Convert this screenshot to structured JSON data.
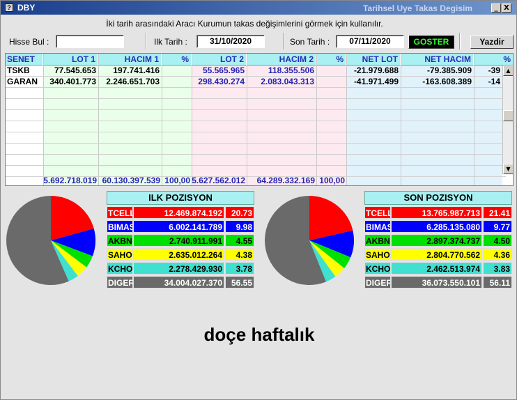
{
  "window": {
    "app_title": "DBY",
    "caption": "Tarihsel Uye Takas Degisim",
    "minimize": "_",
    "close": "X",
    "app_icon": "?"
  },
  "subtitle": "İki tarih arasındaki  Aracı Kurumun takas değişimlerini görmek için kullanılır.",
  "toolbar": {
    "hisse_label": "Hisse Bul :",
    "hisse_value": "",
    "ilk_label": "Ilk Tarih :",
    "ilk_value": "31/10/2020",
    "son_label": "Son Tarih :",
    "son_value": "07/11/2020",
    "goster_label": "GOSTER",
    "yazdir_label": "Yazdir"
  },
  "grid": {
    "headers": [
      "SENET",
      "LOT 1",
      "HACIM 1",
      "%",
      "LOT 2",
      "HACIM 2",
      "%",
      "NET LOT",
      "NET HACIM",
      "%"
    ],
    "rows": [
      [
        "TSKB",
        "77.545.653",
        "197.741.416",
        "",
        "55.565.965",
        "118.355.506",
        "",
        "-21.979.688",
        "-79.385.909",
        "-39"
      ],
      [
        "GARAN",
        "340.401.773",
        "2.246.651.703",
        "",
        "298.430.274",
        "2.083.043.313",
        "",
        "-41.971.499",
        "-163.608.389",
        "-14"
      ]
    ],
    "footer": [
      "",
      "5.692.718.019",
      "60.130.397.539",
      "100,00",
      "5.627.562.012",
      "64.289.332.169",
      "100,00",
      "",
      "",
      ""
    ]
  },
  "ilk_pozisyon": {
    "title": "ILK POZISYON",
    "rows": [
      {
        "name": "TCELL",
        "value": "12.469.874.192",
        "pct": "20.73",
        "pct_num": 20.73,
        "color": "#ff0000",
        "text": "#ffffff"
      },
      {
        "name": "BIMAS",
        "value": "6.002.141.789",
        "pct": "9.98",
        "pct_num": 9.98,
        "color": "#0000ff",
        "text": "#ffffff"
      },
      {
        "name": "AKBNK",
        "value": "2.740.911.991",
        "pct": "4.55",
        "pct_num": 4.55,
        "color": "#00e000",
        "text": "#000000"
      },
      {
        "name": "SAHOL",
        "value": "2.635.012.264",
        "pct": "4.38",
        "pct_num": 4.38,
        "color": "#ffff00",
        "text": "#000000"
      },
      {
        "name": "KCHOL",
        "value": "2.278.429.930",
        "pct": "3.78",
        "pct_num": 3.78,
        "color": "#40e0d0",
        "text": "#000000"
      },
      {
        "name": "DIGER",
        "value": "34.004.027.370",
        "pct": "56.55",
        "pct_num": 56.55,
        "color": "#6a6a6a",
        "text": "#ffffff"
      }
    ]
  },
  "son_pozisyon": {
    "title": "SON POZISYON",
    "rows": [
      {
        "name": "TCELL",
        "value": "13.765.987.713",
        "pct": "21.41",
        "pct_num": 21.41,
        "color": "#ff0000",
        "text": "#ffffff"
      },
      {
        "name": "BIMAS",
        "value": "6.285.135.080",
        "pct": "9.77",
        "pct_num": 9.77,
        "color": "#0000ff",
        "text": "#ffffff"
      },
      {
        "name": "AKBNK",
        "value": "2.897.374.737",
        "pct": "4.50",
        "pct_num": 4.5,
        "color": "#00e000",
        "text": "#000000"
      },
      {
        "name": "SAHOL",
        "value": "2.804.770.562",
        "pct": "4.36",
        "pct_num": 4.36,
        "color": "#ffff00",
        "text": "#000000"
      },
      {
        "name": "KCHOL",
        "value": "2.462.513.974",
        "pct": "3.83",
        "pct_num": 3.83,
        "color": "#40e0d0",
        "text": "#000000"
      },
      {
        "name": "DIGER",
        "value": "36.073.550.101",
        "pct": "56.11",
        "pct_num": 56.11,
        "color": "#6a6a6a",
        "text": "#ffffff"
      }
    ]
  },
  "watermark": "doçe haftalık",
  "colors": {
    "lot1_bg": "#eaffea",
    "lot2_bg": "#fdeaf0",
    "net_bg": "#e2f2fb",
    "header_bg": "#a8f0f2",
    "negative": "#000000",
    "lot2_text": "#2424b0"
  }
}
